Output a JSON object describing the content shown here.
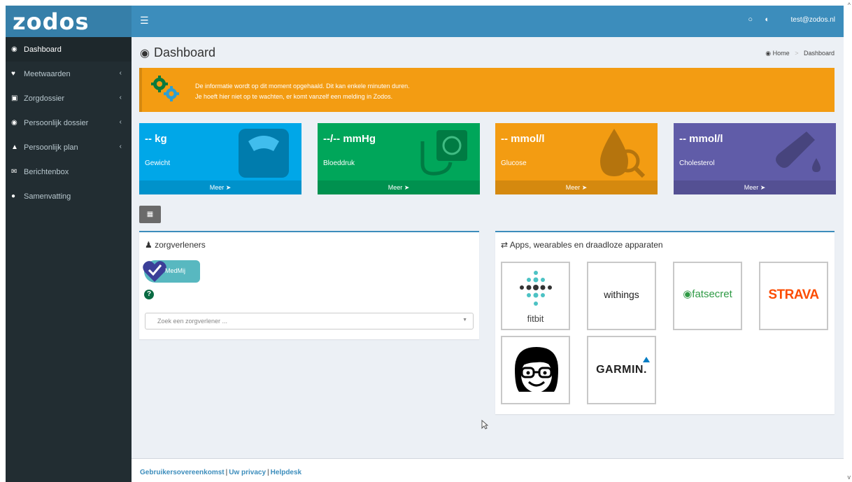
{
  "app": {
    "logo": "zodos",
    "user": "test@zodos.nl"
  },
  "sidebar": {
    "items": [
      {
        "label": "Dashboard"
      },
      {
        "label": "Meetwaarden"
      },
      {
        "label": "Zorgdossier"
      },
      {
        "label": "Persoonlijk dossier"
      },
      {
        "label": "Persoonlijk plan"
      },
      {
        "label": "Berichtenbox"
      },
      {
        "label": "Samenvatting"
      }
    ]
  },
  "header": {
    "title": "Dashboard",
    "breadcrumb": [
      "Home",
      "Dashboard"
    ]
  },
  "alert": {
    "line1": "De informatie wordt op dit moment opgehaald. Dit kan enkele minuten duren.",
    "line2": "Je hoeft hier niet op te wachten, er komt vanzelf een melding in Zodos."
  },
  "boxes": [
    {
      "value": "-- kg",
      "label": "Gewicht",
      "more": "Meer",
      "color": "#00a7e8"
    },
    {
      "value": "--/-- mmHg",
      "label": "Bloeddruk",
      "more": "Meer",
      "color": "#00a65a"
    },
    {
      "value": "-- mmol/l",
      "label": "Glucose",
      "more": "Meer",
      "color": "#f39c12"
    },
    {
      "value": "-- mmol/l",
      "label": "Cholesterol",
      "more": "Meer",
      "color": "#605ca8"
    }
  ],
  "providers": {
    "title": "zorgverleners",
    "medmij": "MedMij",
    "search_placeholder": "Zoek een zorgverlener ..."
  },
  "apps": {
    "title": "Apps, wearables en draadloze apparaten",
    "items": [
      "fitbit",
      "withings",
      "fatsecret",
      "STRAVA",
      "",
      "GARMIN."
    ]
  },
  "footer": {
    "links": [
      "Gebruikersovereenkomst",
      "Uw privacy",
      "Helpdesk"
    ]
  }
}
